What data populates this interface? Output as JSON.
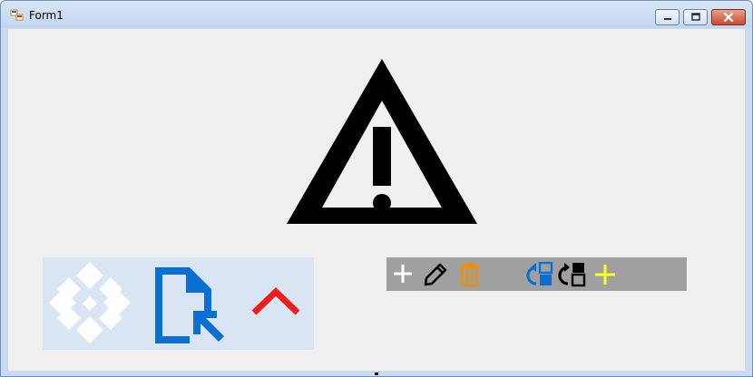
{
  "window": {
    "title": "Form1",
    "icon": "windows-forms-app-icon",
    "caption_buttons": [
      "minimize-icon",
      "maximize-icon",
      "close-icon"
    ]
  },
  "content": {
    "main_icon": "warning-icon",
    "left_panel_icons": [
      "diamond-grid-icon",
      "file-cursor-icon",
      "chevron-up-icon"
    ],
    "right_toolbar_icons": [
      "add-icon",
      "edit-icon",
      "delete-icon",
      "rotate-left-icon",
      "rotate-right-icon",
      "add-icon-yellow"
    ]
  },
  "colors": {
    "window_frame": "#c9dbf0",
    "client_background": "#f0f0f0",
    "left_panel_background": "#dae5f3",
    "right_toolbar_background": "#a0a0a0",
    "accent_blue": "#0a6fd1",
    "accent_red": "#ee1c1c",
    "accent_orange": "#f0900a",
    "accent_yellow": "#ffff1e"
  }
}
